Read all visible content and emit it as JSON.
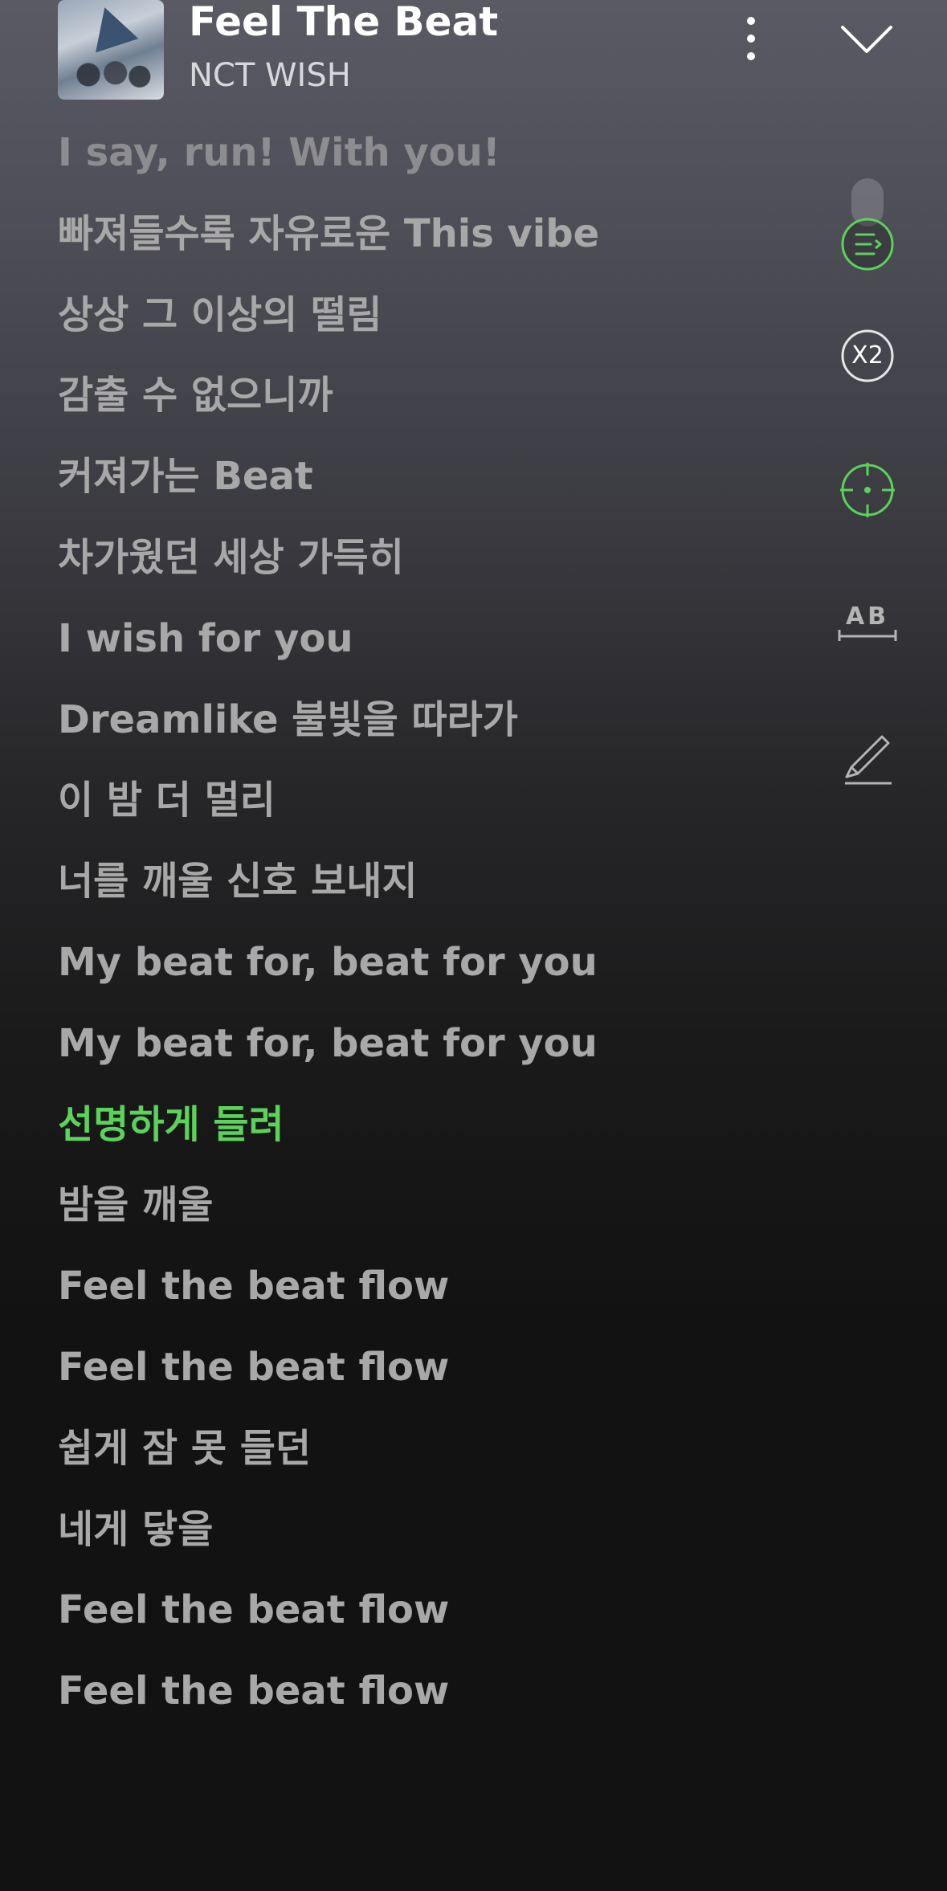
{
  "header": {
    "song_title": "Feel The Beat",
    "artist": "NCT WISH"
  },
  "lyrics": [
    {
      "text": "I say, run! With you!",
      "state": "faded"
    },
    {
      "text": "빠져들수록 자유로운 This vibe",
      "state": "normal"
    },
    {
      "text": "상상 그 이상의 떨림",
      "state": "normal"
    },
    {
      "text": "감출 수 없으니까",
      "state": "normal"
    },
    {
      "text": "커져가는 Beat",
      "state": "normal"
    },
    {
      "text": "차가웠던 세상 가득히",
      "state": "normal"
    },
    {
      "text": "I wish for you",
      "state": "normal"
    },
    {
      "text": "Dreamlike 불빛을 따라가",
      "state": "normal"
    },
    {
      "text": "이 밤 더 멀리",
      "state": "normal"
    },
    {
      "text": "너를 깨울 신호 보내지",
      "state": "normal"
    },
    {
      "text": "My beat for, beat for you",
      "state": "normal"
    },
    {
      "text": "My beat for, beat for you",
      "state": "normal"
    },
    {
      "text": "선명하게 들려",
      "state": "active"
    },
    {
      "text": "밤을 깨울",
      "state": "normal"
    },
    {
      "text": "Feel the beat flow",
      "state": "normal"
    },
    {
      "text": "Feel the beat flow",
      "state": "normal"
    },
    {
      "text": "쉽게 잠 못 들던",
      "state": "normal"
    },
    {
      "text": "네게 닿을",
      "state": "normal"
    },
    {
      "text": "Feel the beat flow",
      "state": "normal"
    },
    {
      "text": "Feel the beat flow",
      "state": "normal"
    }
  ],
  "side_controls": {
    "speed_label": "X2",
    "translate_label": "AB"
  },
  "colors": {
    "accent": "#5bd25a",
    "lyric_text": "#a8a8a8",
    "title_text": "#ffffff"
  },
  "icons": [
    "more-vertical-icon",
    "chevron-down-icon",
    "queue-icon",
    "speed-icon",
    "focus-target-icon",
    "translate-icon",
    "highlight-pen-icon"
  ]
}
